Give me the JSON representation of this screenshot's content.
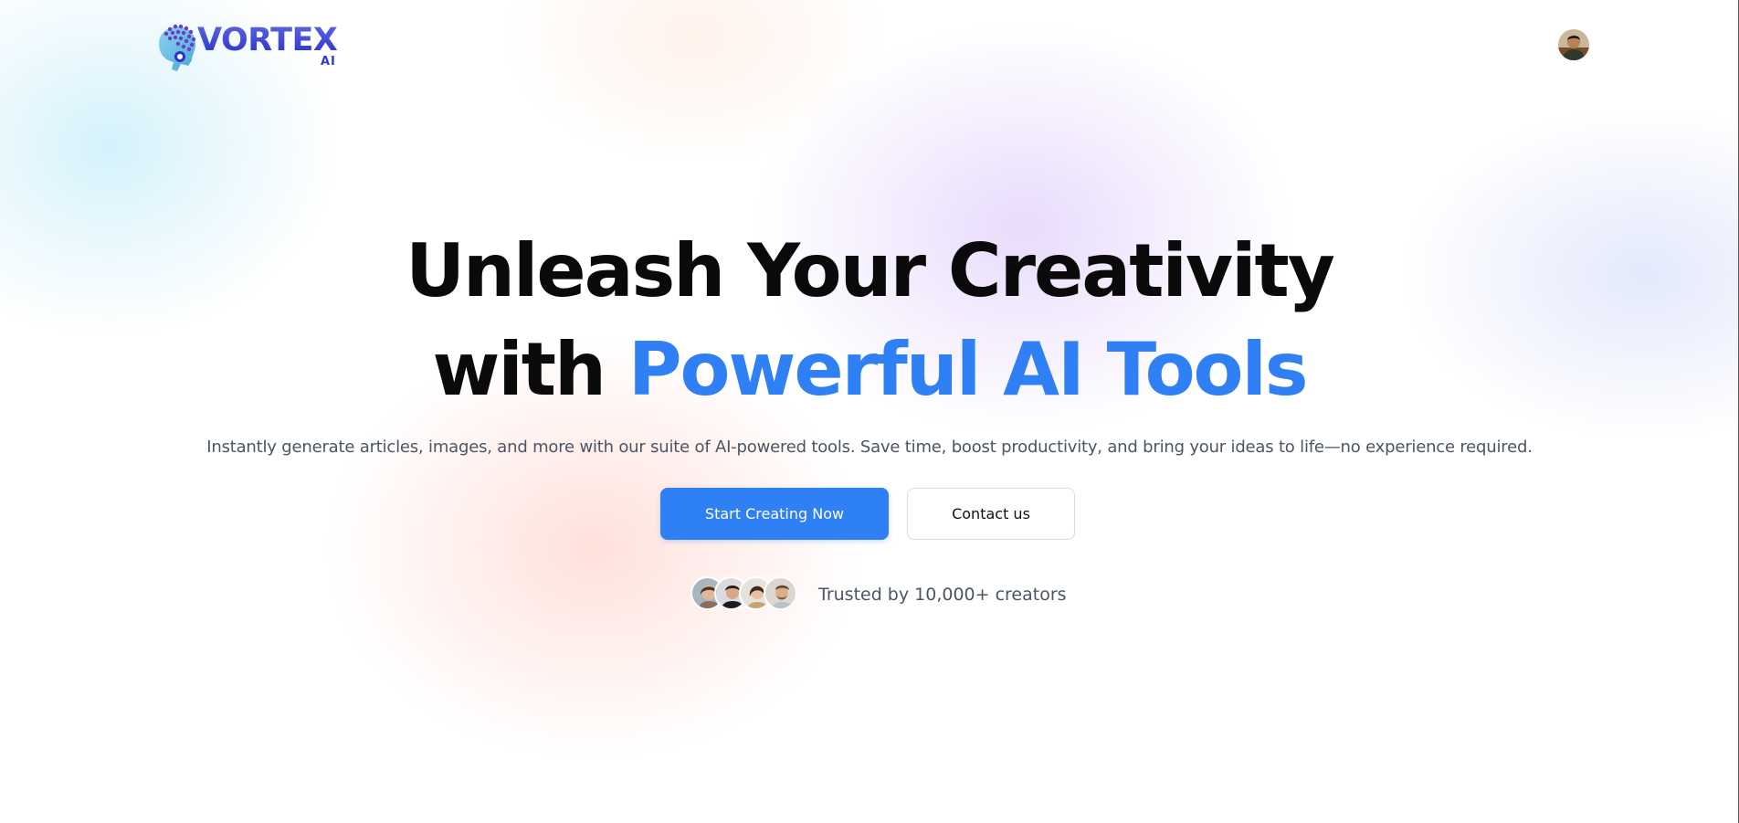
{
  "header": {
    "logo": {
      "word": "VORTEX",
      "sub": "AI",
      "icon": "brain-head-icon"
    },
    "user_avatar": {
      "icon": "user-avatar"
    }
  },
  "hero": {
    "title_line1": "Unleash Your Creativity",
    "title_line2_prefix": "with",
    "title_line2_accent": "Powerful AI Tools",
    "subtitle": "Instantly generate articles, images, and more with our suite of AI-powered tools. Save time, boost productivity, and bring your ideas to life—no experience required.",
    "primary_cta": "Start Creating Now",
    "secondary_cta": "Contact us",
    "trust_text": "Trusted by 10,000+ creators",
    "trust_avatars": [
      "creator-avatar-1",
      "creator-avatar-2",
      "creator-avatar-3",
      "creator-avatar-4"
    ]
  },
  "colors": {
    "accent": "#2f80f5",
    "text_dark": "#0a0a0a",
    "text_muted": "#4b5563",
    "logo": "#2f3bd0"
  }
}
